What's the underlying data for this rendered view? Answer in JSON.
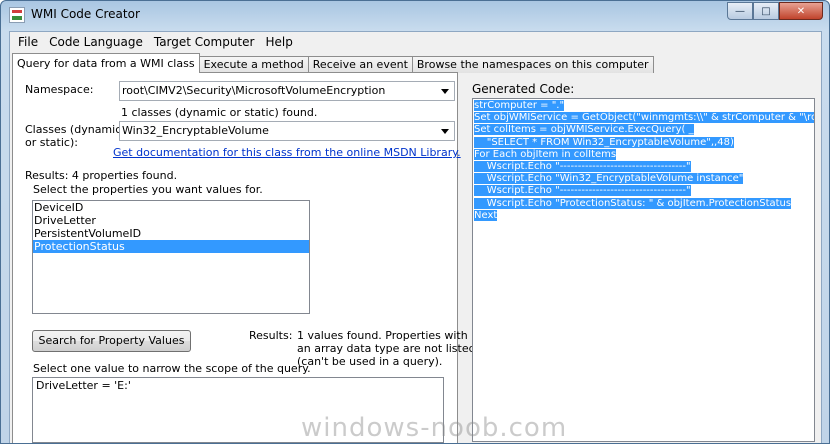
{
  "window": {
    "title": "WMI Code Creator"
  },
  "menu": [
    "File",
    "Code Language",
    "Target Computer",
    "Help"
  ],
  "tabs": [
    "Query for data from a WMI class",
    "Execute a method",
    "Receive an event",
    "Browse the namespaces on this computer"
  ],
  "query": {
    "namespace_label": "Namespace:",
    "namespace_value": "root\\CIMV2\\Security\\MicrosoftVolumeEncryption",
    "classes_found": "1 classes (dynamic or static) found.",
    "classes_label_1": "Classes (dynamic",
    "classes_label_2": "or static):",
    "class_value": "Win32_EncryptableVolume",
    "doc_link": "Get documentation for this class from the online MSDN Library.",
    "results_label": "Results:  4 properties found.",
    "select_props": "Select the properties you want values for.",
    "properties": [
      "DeviceID",
      "DriveLetter",
      "PersistentVolumeID",
      "ProtectionStatus"
    ],
    "selected_property_index": 3,
    "search_button": "Search for Property Values",
    "values_results_label": "Results:",
    "values_results_text_1": "1 values found. Properties with",
    "values_results_text_2": "an array data type are not listed",
    "values_results_text_3": "(can't be used in a query).",
    "select_value_text": "Select one value to narrow the scope of the query.",
    "values": [
      "DriveLetter = 'E:'"
    ]
  },
  "code": {
    "label": "Generated Code:",
    "lines": [
      "strComputer = \".\"",
      "Set objWMIService = GetObject(\"winmgmts:\\\\\" & strComputer & \"\\root",
      "Set colItems = objWMIService.ExecQuery( _",
      "    \"SELECT * FROM Win32_EncryptableVolume\",,48)",
      "For Each objItem in colItems",
      "    Wscript.Echo \"-----------------------------------\"",
      "    Wscript.Echo \"Win32_EncryptableVolume instance\"",
      "    Wscript.Echo \"-----------------------------------\"",
      "    Wscript.Echo \"ProtectionStatus: \" & objItem.ProtectionStatus",
      "Next"
    ]
  },
  "watermark": "windows-noob.com"
}
